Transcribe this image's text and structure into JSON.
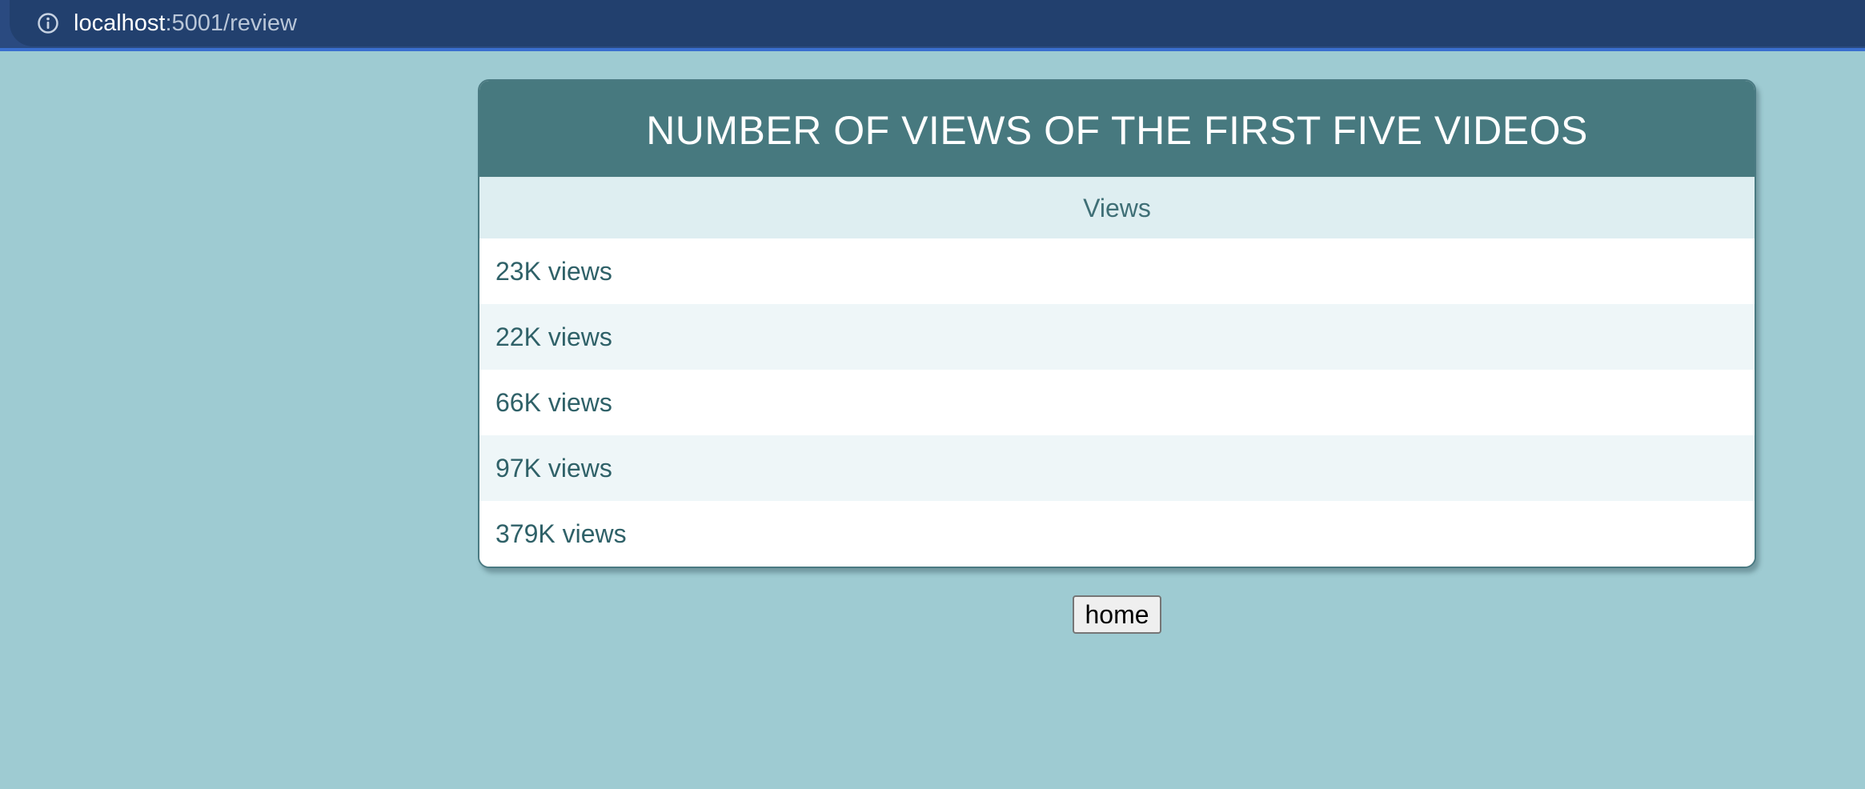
{
  "browser": {
    "url_host": "localhost",
    "url_path": ":5001/review",
    "icons": {
      "site_info": "info-circle-icon"
    }
  },
  "card": {
    "title": "NUMBER OF VIEWS OF THE FIRST FIVE VIDEOS",
    "column_header": "Views",
    "rows": [
      "23K views",
      "22K views",
      "66K views",
      "97K views",
      "379K views"
    ]
  },
  "home_label": "home",
  "colors": {
    "page_background": "#9ecbd2",
    "header_background": "#47797f",
    "browser_bar": "#22406e",
    "text_teal": "#2f6168"
  }
}
